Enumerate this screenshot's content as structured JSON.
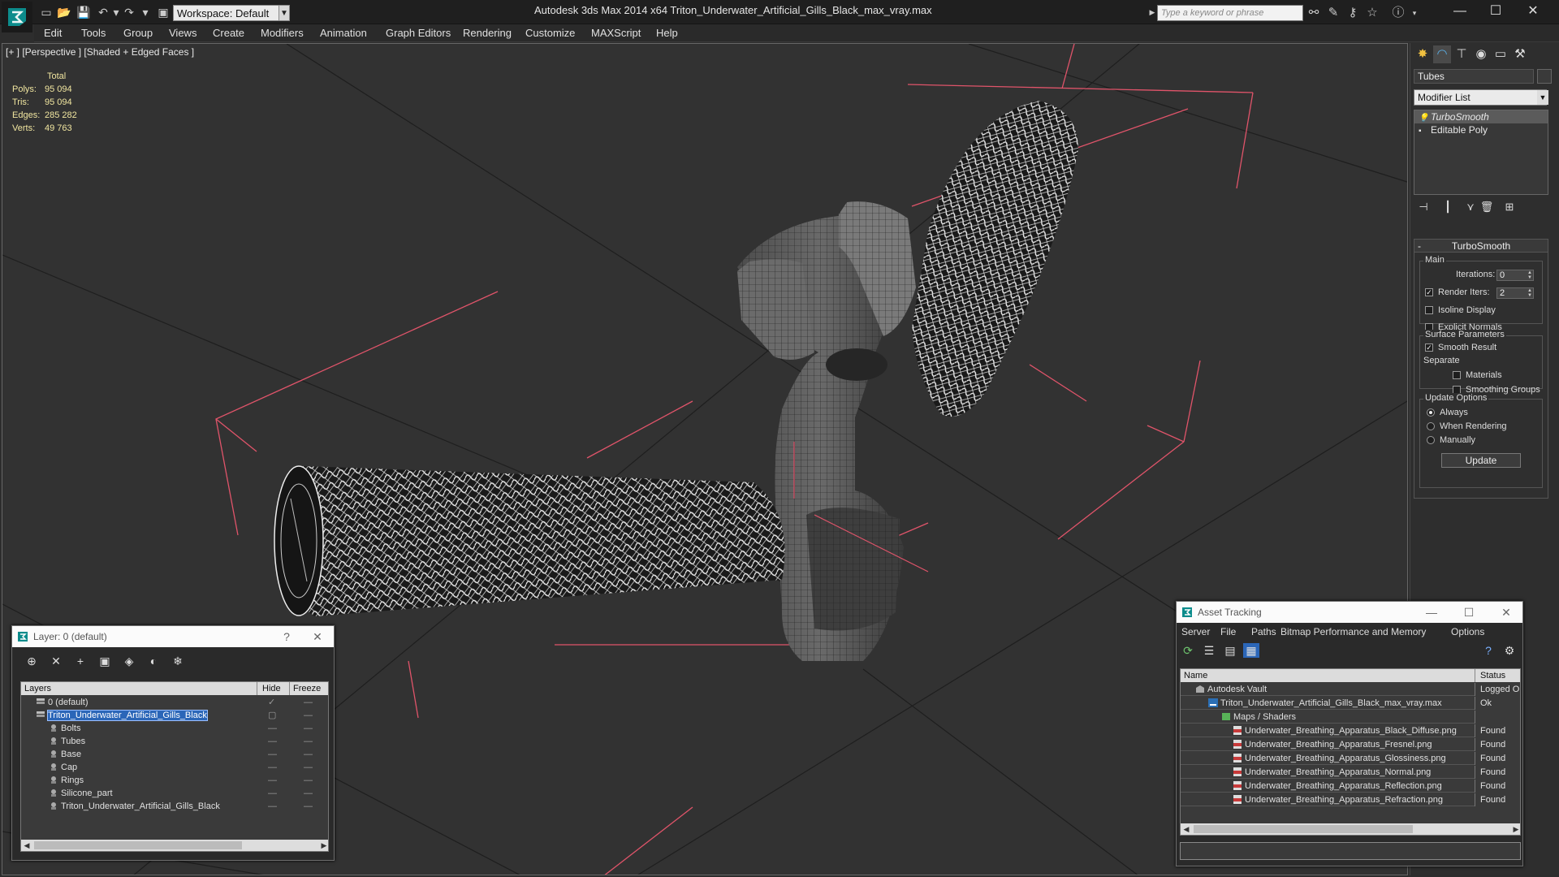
{
  "app": {
    "title": "Autodesk 3ds Max  2014 x64     Triton_Underwater_Artificial_Gills_Black_max_vray.max",
    "workspace": "Workspace: Default",
    "search_placeholder": "Type a keyword or phrase"
  },
  "menu": [
    "Edit",
    "Tools",
    "Group",
    "Views",
    "Create",
    "Modifiers",
    "Animation",
    "Graph Editors",
    "Rendering",
    "Customize",
    "MAXScript",
    "Help"
  ],
  "viewport": {
    "label": "[+ ] [Perspective ] [Shaded + Edged Faces ]",
    "stats": {
      "header": "Total",
      "rows": [
        {
          "k": "Polys:",
          "v": "95 094"
        },
        {
          "k": "Tris:",
          "v": "95 094"
        },
        {
          "k": "Edges:",
          "v": "285 282"
        },
        {
          "k": "Verts:",
          "v": "49 763"
        }
      ]
    }
  },
  "command_panel": {
    "object_name": "Tubes",
    "modifier_list": "Modifier List",
    "stack": [
      "TurboSmooth",
      "Editable Poly"
    ],
    "turbosmooth": {
      "title": "TurboSmooth",
      "main_label": "Main",
      "iterations_label": "Iterations:",
      "iterations": "0",
      "render_iters_label": "Render Iters:",
      "render_iters": "2",
      "isoline": "Isoline Display",
      "explicit_normals": "Explicit Normals",
      "surface_params": "Surface Parameters",
      "smooth_result": "Smooth Result",
      "separate": "Separate",
      "materials": "Materials",
      "smoothing_groups": "Smoothing Groups",
      "update_options": "Update Options",
      "always": "Always",
      "when_rendering": "When Rendering",
      "manually": "Manually",
      "update_button": "Update"
    }
  },
  "layer_window": {
    "title": "Layer: 0 (default)",
    "help": "?",
    "columns": {
      "layers": "Layers",
      "hide": "Hide",
      "freeze": "Freeze"
    },
    "rows": [
      {
        "name": "0 (default)",
        "level": 0
      },
      {
        "name": "Triton_Underwater_Artificial_Gills_Black",
        "level": 0
      },
      {
        "name": "Bolts",
        "level": 1
      },
      {
        "name": "Tubes",
        "level": 1
      },
      {
        "name": "Base",
        "level": 1
      },
      {
        "name": "Cap",
        "level": 1
      },
      {
        "name": "Rings",
        "level": 1
      },
      {
        "name": "Silicone_part",
        "level": 1
      },
      {
        "name": "Triton_Underwater_Artificial_Gills_Black",
        "level": 1
      }
    ]
  },
  "asset_window": {
    "title": "Asset Tracking",
    "menu": [
      "Server",
      "File",
      "Paths",
      "Bitmap Performance and Memory",
      "Options"
    ],
    "columns": {
      "name": "Name",
      "status": "Status"
    },
    "rows": [
      {
        "name": "Autodesk Vault",
        "status": "Logged O"
      },
      {
        "name": "Triton_Underwater_Artificial_Gills_Black_max_vray.max",
        "status": "Ok"
      },
      {
        "name": "Maps / Shaders",
        "status": ""
      },
      {
        "name": "Underwater_Breathing_Apparatus_Black_Diffuse.png",
        "status": "Found"
      },
      {
        "name": "Underwater_Breathing_Apparatus_Fresnel.png",
        "status": "Found"
      },
      {
        "name": "Underwater_Breathing_Apparatus_Glossiness.png",
        "status": "Found"
      },
      {
        "name": "Underwater_Breathing_Apparatus_Normal.png",
        "status": "Found"
      },
      {
        "name": "Underwater_Breathing_Apparatus_Reflection.png",
        "status": "Found"
      },
      {
        "name": "Underwater_Breathing_Apparatus_Refraction.png",
        "status": "Found"
      }
    ]
  },
  "colors": {
    "selection": "#2b66b8",
    "stats_text": "#f1e6a0",
    "bbox_lines": "#e0546a"
  },
  "icons": [
    "app-logo-icon",
    "new-file-icon",
    "open-icon",
    "save-icon",
    "undo-icon",
    "redo-icon",
    "search-icon",
    "help-icon",
    "minimize-icon",
    "maximize-icon",
    "close-icon"
  ]
}
